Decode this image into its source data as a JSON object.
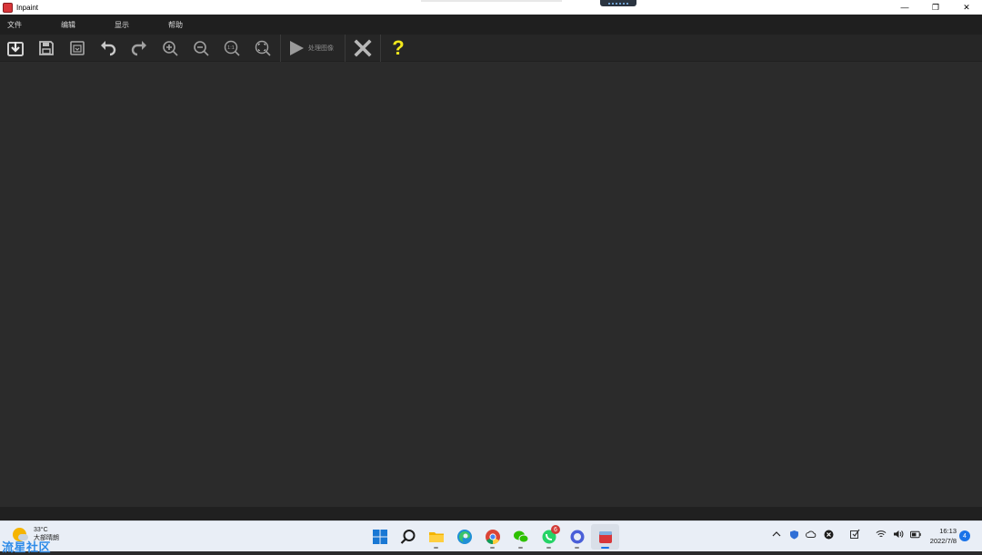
{
  "window": {
    "title": "Inpaint",
    "minimize_glyph": "—",
    "restore_glyph": "❐",
    "close_glyph": "✕"
  },
  "menu": {
    "items": [
      {
        "label": "文件"
      },
      {
        "label": "编辑"
      },
      {
        "label": "显示"
      },
      {
        "label": "帮助"
      }
    ]
  },
  "toolbar": {
    "buttons": [
      {
        "icon": "open-file-icon"
      },
      {
        "icon": "save-icon"
      },
      {
        "icon": "save-as-icon"
      },
      {
        "icon": "undo-icon"
      },
      {
        "icon": "redo-icon"
      },
      {
        "icon": "zoom-in-icon"
      },
      {
        "icon": "zoom-out-icon"
      },
      {
        "icon": "actual-size-icon",
        "text": "1:1"
      },
      {
        "icon": "fit-window-icon"
      }
    ],
    "run_label": "处理图像",
    "close_icon": "x-icon",
    "help_glyph": "?",
    "help_color": "#f2e81c"
  },
  "taskbar": {
    "weather": {
      "temp": "33°C",
      "desc": "大部晴朗"
    },
    "watermark": "流星社区",
    "apps": [
      {
        "icon": "windows-start-icon"
      },
      {
        "icon": "search-icon"
      },
      {
        "icon": "file-explorer-icon"
      },
      {
        "icon": "edge-icon"
      },
      {
        "icon": "chrome-icon"
      },
      {
        "icon": "wechat-icon"
      },
      {
        "icon": "whatsapp-icon",
        "badge": "6"
      },
      {
        "icon": "browser-icon"
      },
      {
        "icon": "inpaint-app-icon"
      }
    ],
    "clock": {
      "time": "16:13",
      "date": "2022/7/8"
    },
    "notifications": "4"
  }
}
